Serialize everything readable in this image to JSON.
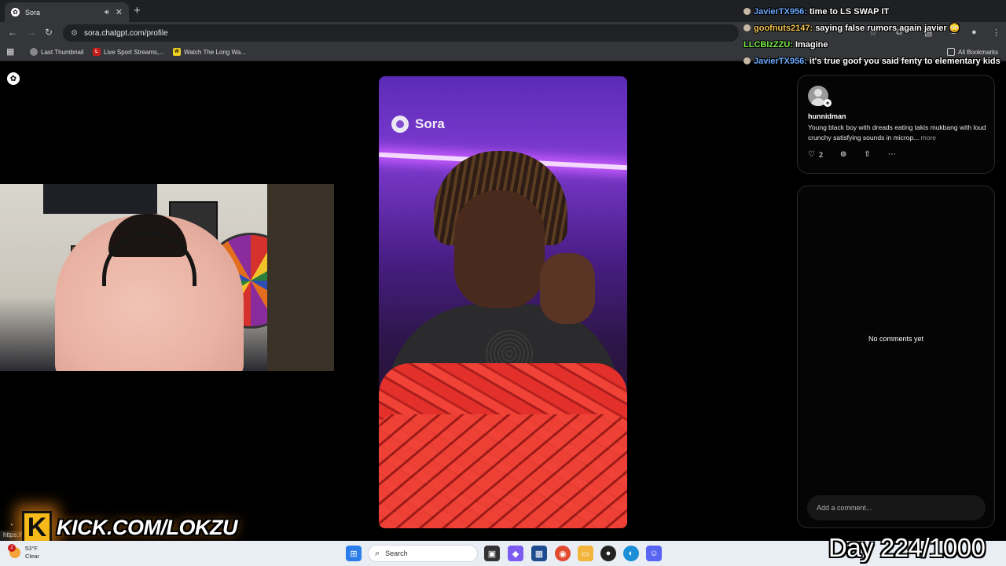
{
  "browser": {
    "tab_title": "Sora",
    "url": "sora.chatgpt.com/profile",
    "bookmarks": [
      "Last Thumbnail",
      "Live Sport Streams,...",
      "Watch The Long Wa..."
    ],
    "all_bookmarks": "All Bookmarks",
    "status_url": "https://..."
  },
  "chat": [
    {
      "user": "JavierTX956:",
      "color": "#6aa9ff",
      "message": "time to LS SWAP IT"
    },
    {
      "user": "goofnuts2147:",
      "color": "#f3c64f",
      "message": "saying false rumors again javier 😳"
    },
    {
      "user": "LLCBIzZZU:",
      "color": "#7cf04a",
      "message": "Imagine"
    },
    {
      "user": "JavierTX956:",
      "color": "#6aa9ff",
      "message": "it's true goof you said fenty to elementary kids"
    }
  ],
  "video": {
    "watermark": "Sora"
  },
  "post": {
    "username": "hunnidman",
    "description": "Young black boy with dreads eating takis mukbang with loud crunchy satisfying sounds in microp...",
    "more": "more",
    "likes": "2"
  },
  "comments": {
    "empty_text": "No comments yet",
    "placeholder": "Add a comment..."
  },
  "overlay": {
    "kick_letter": "K",
    "kick_url": "KICK.COM/LOKZU",
    "day_counter": "Day 224/1000"
  },
  "taskbar": {
    "temperature": "53°F",
    "condition": "Clear",
    "weather_badge": "2",
    "search": "Search"
  }
}
